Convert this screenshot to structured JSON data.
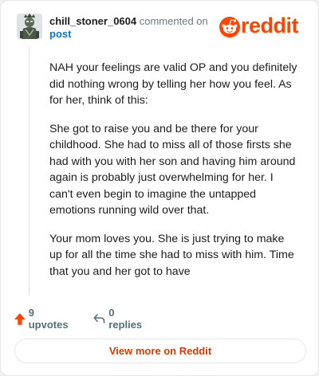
{
  "comment": {
    "author": "chill_stoner_0604",
    "action_text": "commented on",
    "post_link": "post",
    "paragraphs": [
      "NAH your feelings are valid OP and you definitely did nothing wrong by telling her how you feel. As for her, think of this:",
      "She got to raise you and be there for your childhood. She had to miss all of those firsts she had with you with her son and having him around again is probably just overwhelming for her. I can't even begin to imagine the untapped emotions running wild over that.",
      "Your mom loves you. She is just trying to make up for all the time she had to miss with him. Time that you and her got to have"
    ]
  },
  "brand": {
    "name": "reddit",
    "color": "#ff4500",
    "icon": "reddit-snoo-icon"
  },
  "stats": {
    "upvotes": "9 upvotes",
    "replies": "0 replies",
    "upvote_icon": "upvote-arrow-icon",
    "reply_icon": "reply-arrow-icon"
  },
  "cta": {
    "label": "View more on Reddit"
  },
  "colors": {
    "accent": "#ff4500",
    "link": "#0079d3",
    "muted": "#576f76",
    "cta_text": "#d93a00"
  }
}
